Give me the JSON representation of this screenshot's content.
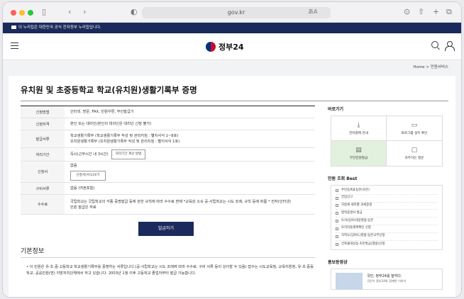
{
  "browser": {
    "address": "gov.kr",
    "icons": [
      "sidebar-icon",
      "back-icon",
      "forward-icon",
      "shield-icon",
      "translate-icon",
      "download-icon",
      "share-icon",
      "new-tab-icon",
      "tabs-icon"
    ]
  },
  "banner": {
    "text": "이 누리집은 대한민국 공식 전자정부 누리집입니다."
  },
  "header": {
    "logo_text": "정부24"
  },
  "breadcrumb": {
    "home": "Home",
    "separator": ">",
    "current": "민원서비스"
  },
  "page": {
    "title": "유치원 및 초중등학교 학교(유치원)생활기록부 증명",
    "rows": [
      {
        "key": "신청방법",
        "lines": [
          "인터넷, 방문, FAX, 민원우편, 무인발급기"
        ]
      },
      {
        "key": "신청자격",
        "lines": [
          "본인 또는 대리인(본인의 대리인은 대리인 신청 불가)"
        ]
      },
      {
        "key": "발급서류",
        "lines": [
          "학교생활기록부 (학교생활기록부 작성 및 관리지침 : 별지서식 1~8호)",
          "유치원생활기록부 (유치원생활기록부 작성 및 관리지침 : 별지서식 1호)"
        ]
      },
      {
        "key": "처리기간",
        "lines": [
          "즉시(근무시간 내 3시간)"
        ],
        "button": "처리기간 계산 방법"
      },
      {
        "key": "신청서",
        "lines": [
          "없음"
        ],
        "button": "신청서(서식)보기"
      },
      {
        "key": "구비서류",
        "lines": [
          "없음 (여권포함)"
        ]
      },
      {
        "key": "수수료",
        "lines": [
          "국립학교는 국립학교의 각종 증명발급 등에 관한 규칙에 따라 수수료 면제 *교육감 소속 공·사립학교는 시도 조례, 규칙 등에 따름 * 전자(인터넷)",
          "민원 발급은 무료"
        ]
      }
    ],
    "apply_label": "발급하기",
    "section_title": "기본정보",
    "bullet": "이 민원은 유·초·중·고등학교 학교생활기록부를 증명하는 서류입니다.(공·사립학교는 시도 조례에 따라 수수료, 구비 서류 등이 상이할 수 있음) 접수는 시도교육청, 교육지원청, 유·초·중등학교, 공공민원(면) 지방자치단체에서 하고 있습니다. 2003년 1월 이후 고등학교 졸업자부터 발급 가능합니다."
  },
  "sidebar": {
    "shortcuts_title": "바로가기",
    "shortcuts": [
      {
        "label": "전자결제 안내",
        "icon": "download-icon",
        "glyph": "⤓"
      },
      {
        "label": "프로그램 설치 확인",
        "icon": "monitor-check-icon",
        "glyph": "▭"
      },
      {
        "label": "무인민원발급",
        "icon": "kiosk-icon",
        "glyph": "▤"
      },
      {
        "label": "자주하는 질문",
        "icon": "faq-icon",
        "glyph": "▢"
      }
    ],
    "best_title": "민원 조회 Best",
    "best": [
      "주민등록표등본(초본)",
      "전입신고",
      "지방세 세목별 과세증명",
      "병적증명서 발급",
      "토지(임야)대장열람·등본",
      "토지이용계획확인 신청",
      "지적도(임야도)열람·등본교부신청",
      "건축물대장등·초본발급(열람)신청"
    ],
    "promo_title": "홍보동영상",
    "promo_heading": "국민, 정부24를 말하다.",
    "promo_sub": "국민이 정부24와 함께한 이야기"
  },
  "colors": {
    "navy": "#1a2a5c",
    "active_shortcut": "#e2f1dd"
  }
}
